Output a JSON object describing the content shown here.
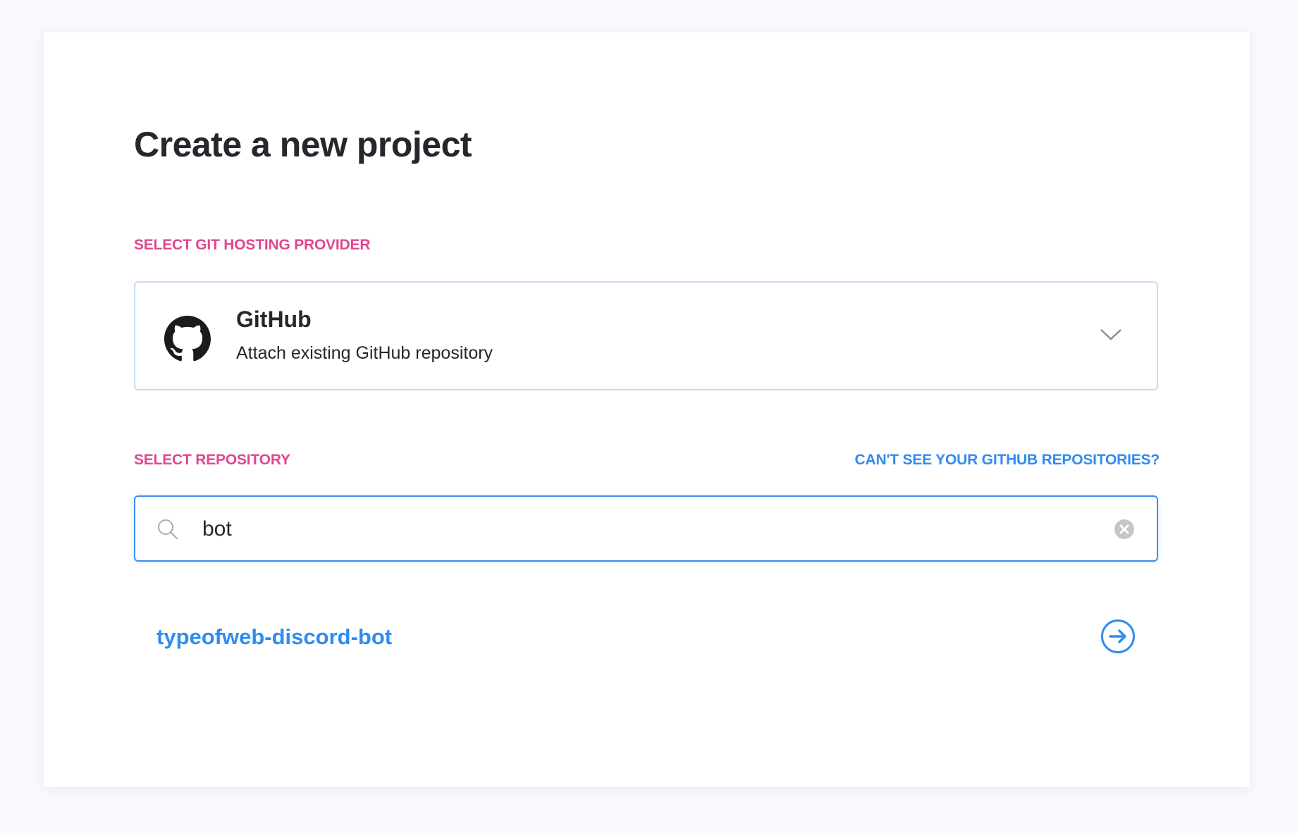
{
  "page": {
    "title": "Create a new project"
  },
  "provider_section": {
    "label": "SELECT GIT HOSTING PROVIDER",
    "selected": {
      "name": "GitHub",
      "description": "Attach existing GitHub repository",
      "icon": "github-icon"
    }
  },
  "repository_section": {
    "label": "SELECT REPOSITORY",
    "help_link": "CAN'T SEE YOUR GITHUB REPOSITORIES?",
    "search": {
      "value": "bot",
      "placeholder": ""
    },
    "results": [
      {
        "name": "typeofweb-discord-bot"
      }
    ]
  },
  "colors": {
    "accent": "#2f8cf0",
    "label": "#e0478e",
    "text": "#24272b"
  }
}
